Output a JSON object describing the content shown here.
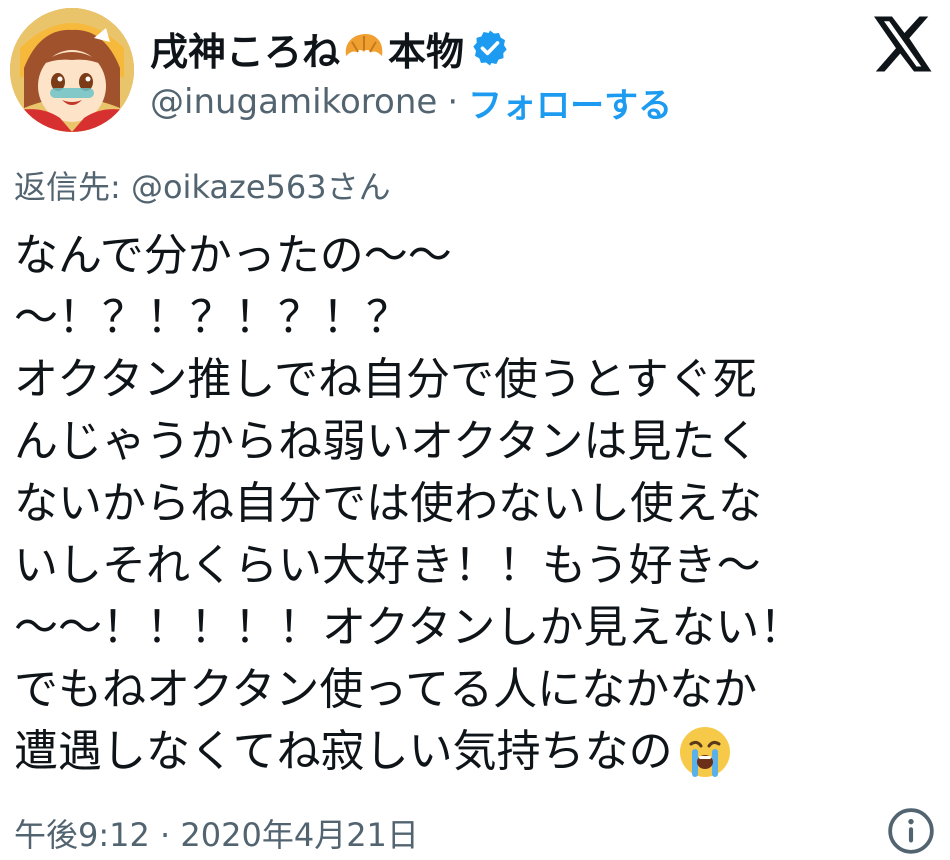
{
  "header": {
    "display_name": "戌神ころね",
    "name_suffix": "本物",
    "name_emoji": "croissant-emoji",
    "verified_icon": "verified-badge-icon",
    "handle": "@inugamikorone",
    "separator": "·",
    "follow_label": "フォローする",
    "logo_icon": "x-logo-icon"
  },
  "reply": {
    "prefix": "返信先: ",
    "handle": "@oikaze563",
    "suffix": "さん"
  },
  "tweet": {
    "lines": [
      "なんで分かったの～～",
      "～！？！？！？！？",
      "オクタン推しでね自分で使うとすぐ死",
      "んじゃうからね弱いオクタンは見たく",
      "ないからね自分では使わないし使えな",
      "いしそれくらい大好き！！もう好き～",
      "～～！！！！！オクタンしか見えない！",
      "でもねオクタン使ってる人になかなか",
      "遭遇しなくてね寂しい気持ちなの"
    ],
    "end_emoji": "loudly-crying-face-emoji"
  },
  "footer": {
    "time": "午後9:12",
    "separator": " · ",
    "date": "2020年4月21日",
    "info_icon": "info-icon"
  },
  "colors": {
    "text": "#0f1419",
    "secondary": "#536471",
    "accent": "#1d9bf0",
    "background": "#ffffff"
  }
}
